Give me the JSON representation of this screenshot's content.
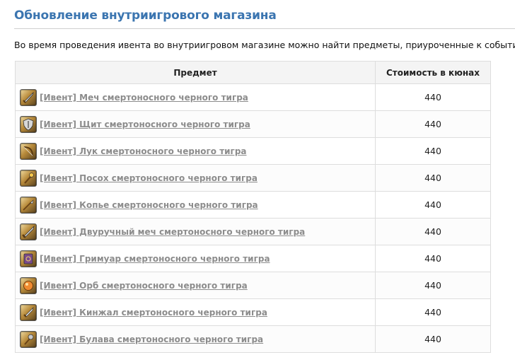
{
  "page": {
    "title": "Обновление внутриигрового магазина",
    "intro": "Во время проведения ивента во внутриигровом магазине можно найти предметы, приуроченные к событию."
  },
  "table": {
    "headers": {
      "item": "Предмет",
      "price": "Стоимость в кюнах"
    },
    "rows": [
      {
        "name": "[Ивент] Меч смертоносного черного тигра",
        "price": "440",
        "icon": "sword-icon"
      },
      {
        "name": "[Ивент] Щит смертоносного черного тигра",
        "price": "440",
        "icon": "shield-icon"
      },
      {
        "name": "[Ивент] Лук смертоносного черного тигра",
        "price": "440",
        "icon": "bow-icon"
      },
      {
        "name": "[Ивент] Посох смертоносного черного тигра",
        "price": "440",
        "icon": "staff-icon"
      },
      {
        "name": "[Ивент] Копье смертоносного черного тигра",
        "price": "440",
        "icon": "spear-icon"
      },
      {
        "name": "[Ивент] Двуручный меч смертоносного черного тигра",
        "price": "440",
        "icon": "greatsword-icon"
      },
      {
        "name": "[Ивент] Гримуар смертоносного черного тигра",
        "price": "440",
        "icon": "grimoire-icon"
      },
      {
        "name": "[Ивент] Орб смертоносного черного тигра",
        "price": "440",
        "icon": "orb-icon"
      },
      {
        "name": "[Ивент] Кинжал смертоносного черного тигра",
        "price": "440",
        "icon": "dagger-icon"
      },
      {
        "name": "[Ивент] Булава смертоносного черного тигра",
        "price": "440",
        "icon": "mace-icon"
      }
    ]
  }
}
